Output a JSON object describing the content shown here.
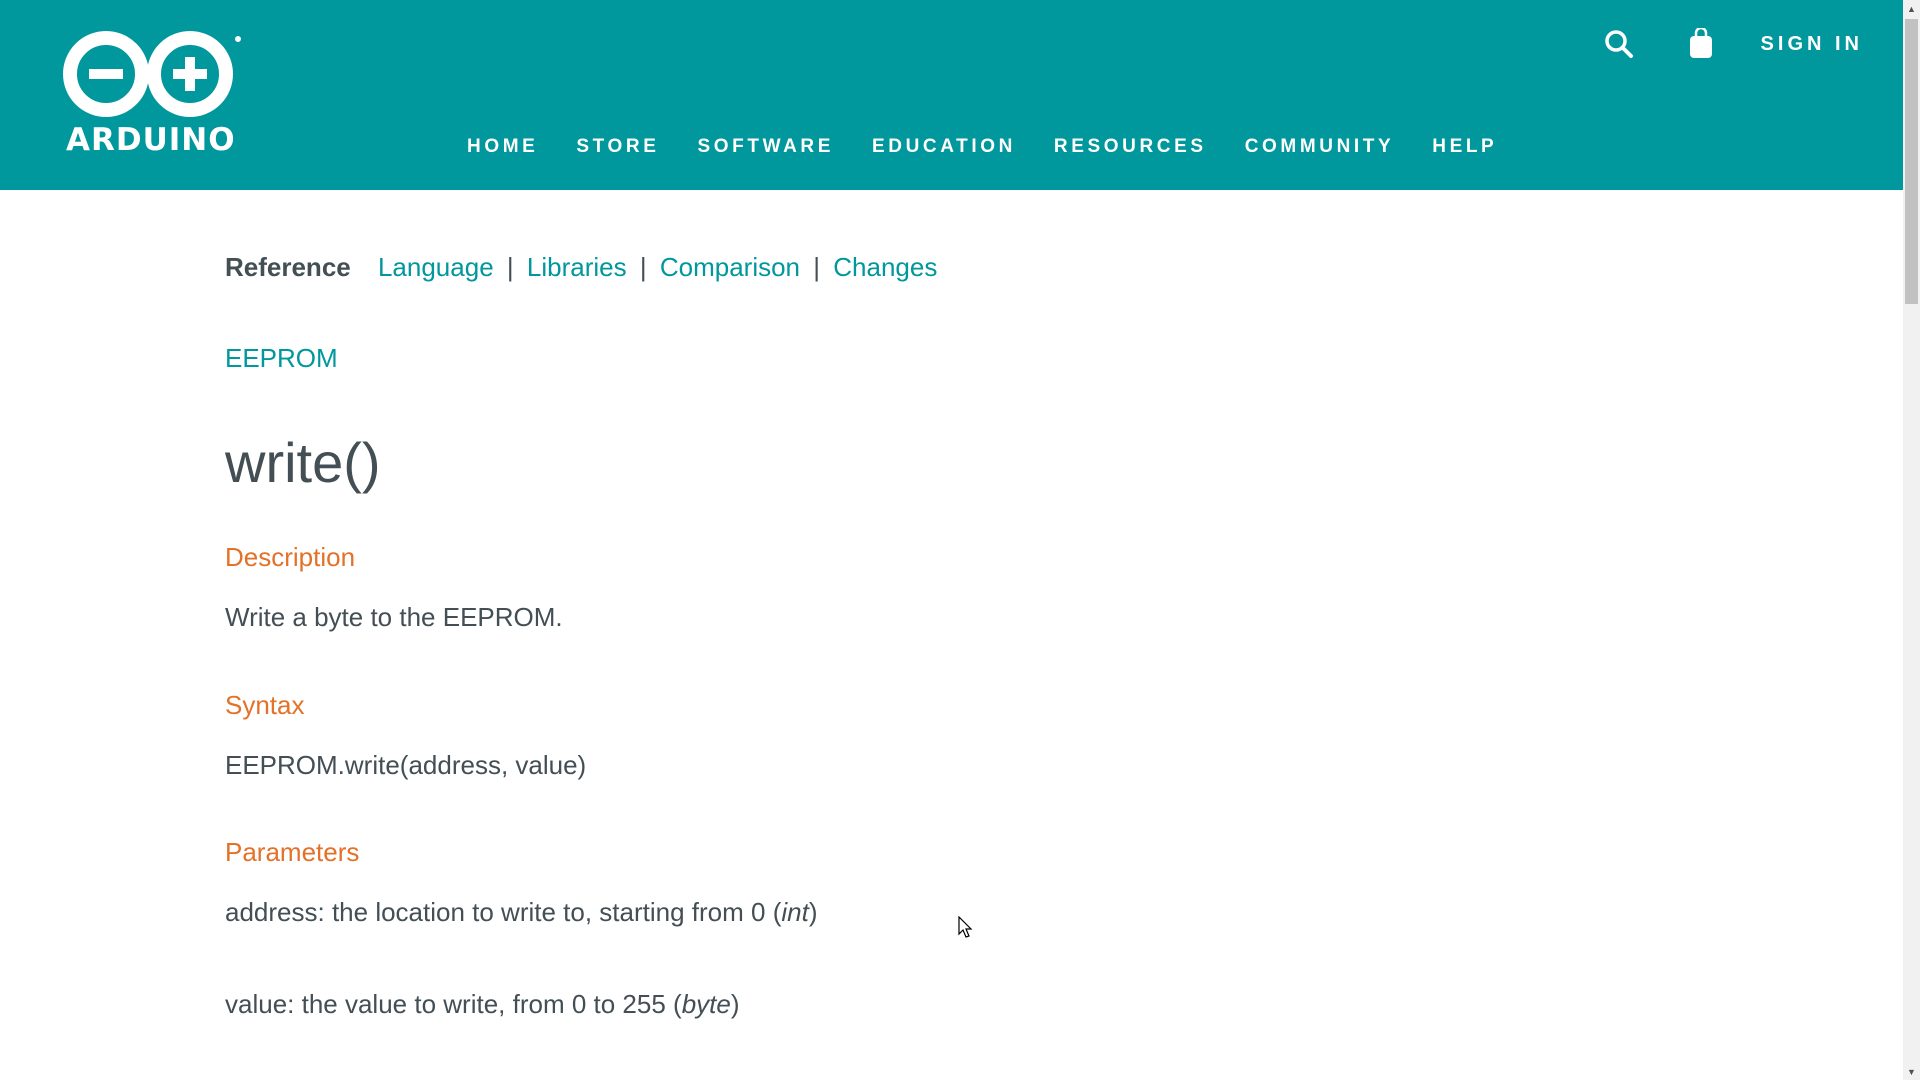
{
  "brand": {
    "name": "ARDUINO",
    "primary_color": "#00979D",
    "heading_color": "#E47128",
    "text_color": "#434f54"
  },
  "header": {
    "icons": [
      "search-icon",
      "cart-icon"
    ],
    "sign_in": "SIGN IN",
    "nav": [
      "HOME",
      "STORE",
      "SOFTWARE",
      "EDUCATION",
      "RESOURCES",
      "COMMUNITY",
      "HELP"
    ]
  },
  "subnav": {
    "reference": "Reference",
    "links": [
      "Language",
      "Libraries",
      "Comparison",
      "Changes"
    ],
    "separator": "|"
  },
  "page": {
    "library": "EEPROM",
    "title": "write()",
    "description_heading": "Description",
    "description": "Write a byte to the EEPROM.",
    "syntax_heading": "Syntax",
    "syntax": "EEPROM.write(address, value)",
    "parameters_heading": "Parameters",
    "param_address_text": "address: the location to write to, starting from 0 (",
    "param_address_type": "int",
    "param_address_close": ")",
    "param_value_text": "value: the value to write, from 0 to 255 (",
    "param_value_type": "byte",
    "param_value_close": ")"
  }
}
